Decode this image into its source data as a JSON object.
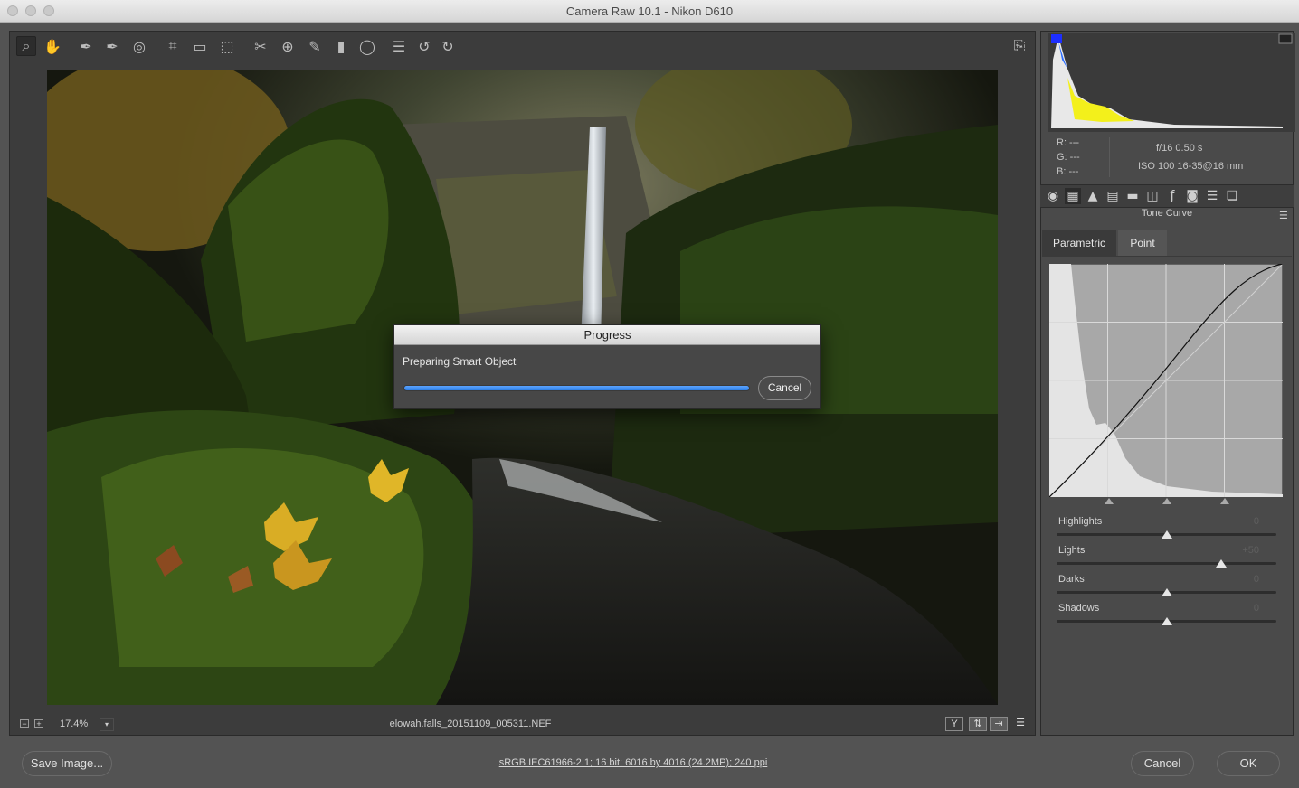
{
  "window": {
    "title": "Camera Raw 10.1  -  Nikon D610"
  },
  "toolbar": {
    "tools": [
      {
        "name": "zoom-tool-icon",
        "glyph": "⌕"
      },
      {
        "name": "hand-tool-icon",
        "glyph": "✋"
      },
      {
        "name": "white-balance-tool-icon",
        "glyph": "✒"
      },
      {
        "name": "color-sampler-tool-icon",
        "glyph": "✒"
      },
      {
        "name": "targeted-adjustment-tool-icon",
        "glyph": "◎"
      },
      {
        "name": "crop-tool-icon",
        "glyph": "⌗"
      },
      {
        "name": "straighten-tool-icon",
        "glyph": "▭"
      },
      {
        "name": "transform-tool-icon",
        "glyph": "⬚"
      },
      {
        "name": "spot-removal-tool-icon",
        "glyph": "✂"
      },
      {
        "name": "red-eye-tool-icon",
        "glyph": "⊕"
      },
      {
        "name": "adjustment-brush-icon",
        "glyph": "✎"
      },
      {
        "name": "graduated-filter-icon",
        "glyph": "▮"
      },
      {
        "name": "radial-filter-icon",
        "glyph": "◯"
      },
      {
        "name": "preferences-icon",
        "glyph": "☰"
      },
      {
        "name": "rotate-left-icon",
        "glyph": "↺"
      },
      {
        "name": "rotate-right-icon",
        "glyph": "↻"
      }
    ],
    "fullscreen_icon": "⎘"
  },
  "dialog": {
    "title": "Progress",
    "message": "Preparing Smart Object",
    "progress_percent": 100,
    "cancel_label": "Cancel"
  },
  "statusbar": {
    "zoom": "17.4%",
    "filename": "elowah.falls_20151109_005311.NEF",
    "view_y_label": "Y"
  },
  "histogram_info": {
    "r": "R:   ---",
    "g": "G:   ---",
    "b": "B:   ---",
    "aperture_shutter": "f/16    0.50 s",
    "iso_lens": "ISO 100    16-35@16 mm"
  },
  "panel": {
    "section_title": "Tone Curve",
    "tabs": [
      "Parametric",
      "Point"
    ],
    "sliders": [
      {
        "label": "Highlights",
        "value": "0",
        "fraction": 0.5
      },
      {
        "label": "Lights",
        "value": "+50",
        "fraction": 0.75
      },
      {
        "label": "Darks",
        "value": "0",
        "fraction": 0.5
      },
      {
        "label": "Shadows",
        "value": "0",
        "fraction": 0.5
      }
    ]
  },
  "bottom": {
    "save_label": "Save Image...",
    "meta_link": "sRGB IEC61966-2.1; 16 bit; 6016 by 4016 (24.2MP); 240 ppi",
    "cancel_label": "Cancel",
    "ok_label": "OK"
  },
  "colors": {
    "accent_progress": "#3b86ee",
    "panel_bg": "#4a4a4a"
  }
}
